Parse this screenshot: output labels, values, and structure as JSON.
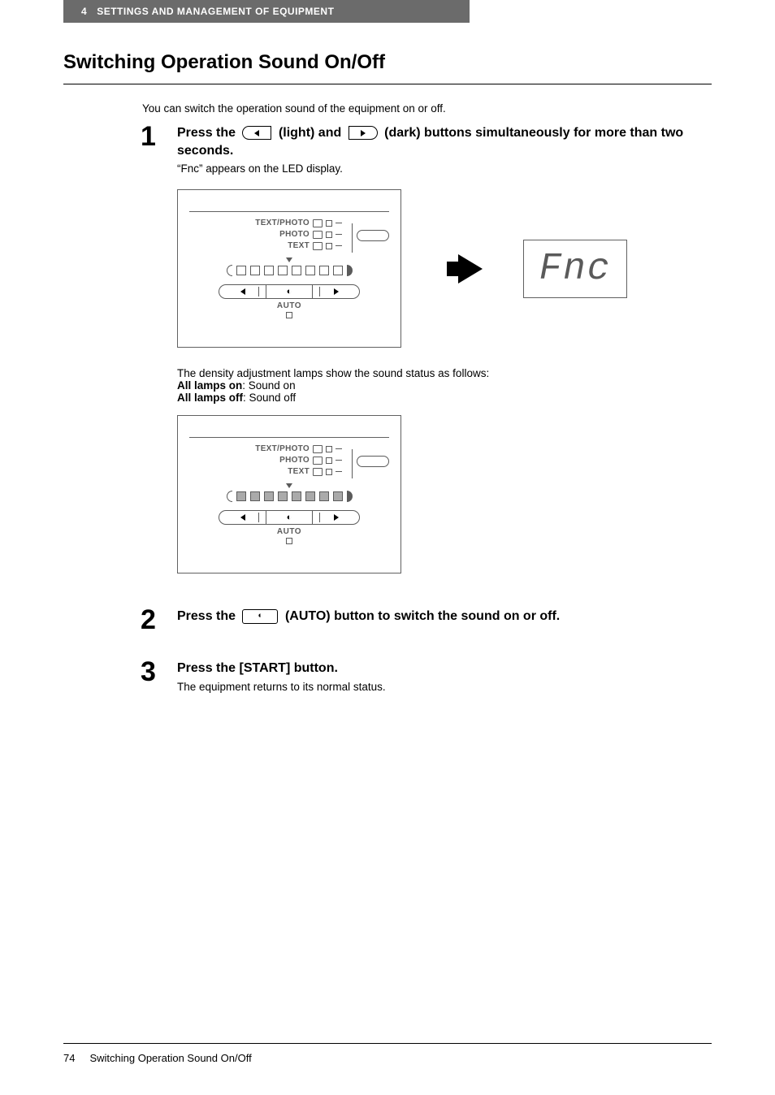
{
  "header": {
    "chapter_num": "4",
    "chapter_title": "SETTINGS AND MANAGEMENT OF EQUIPMENT"
  },
  "title": "Switching Operation Sound On/Off",
  "intro": "You can switch the operation sound of the equipment on or off.",
  "steps": [
    {
      "num": "1",
      "heading_parts": {
        "a": "Press the ",
        "b": " (light) and ",
        "c": " (dark) buttons simultaneously for more than two seconds."
      },
      "note": "“Fnc” appears on the LED display."
    },
    {
      "num": "2",
      "heading_parts": {
        "a": "Press the ",
        "b": " (AUTO) button to switch the sound on or off."
      }
    },
    {
      "num": "3",
      "heading": "Press the [START] button.",
      "note": "The equipment returns to its normal status."
    }
  ],
  "status": {
    "intro": "The density adjustment lamps show the sound status as follows:",
    "on_label": "All lamps on",
    "on_desc": ": Sound on",
    "off_label": "All lamps off",
    "off_desc": ": Sound off"
  },
  "panel": {
    "modes": [
      "TEXT/PHOTO",
      "PHOTO",
      "TEXT"
    ],
    "auto": "AUTO"
  },
  "fnc_display": "Fnc",
  "footer": {
    "page": "74",
    "title": "Switching Operation Sound On/Off"
  }
}
